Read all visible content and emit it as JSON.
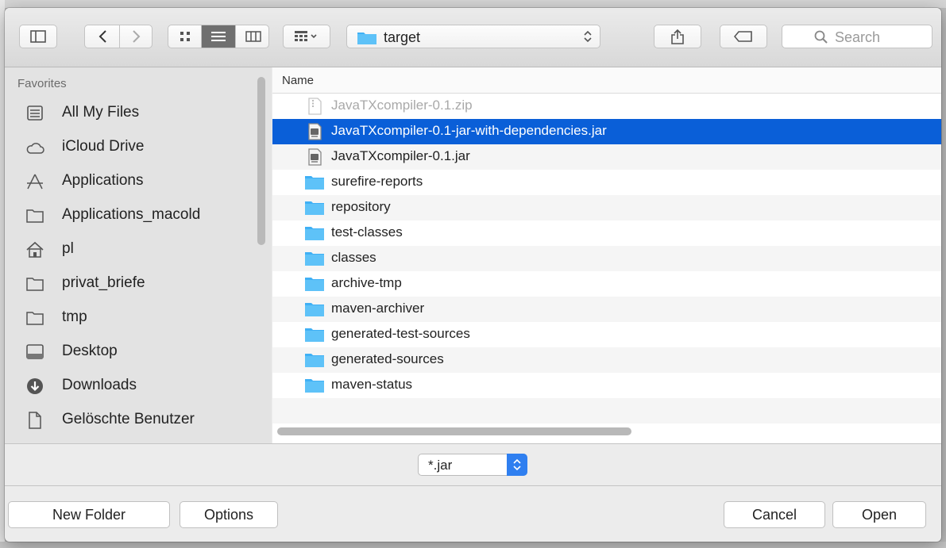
{
  "toolbar": {
    "path_folder": "target",
    "search_placeholder": "Search"
  },
  "sidebar": {
    "section_title": "Favorites",
    "items": [
      {
        "label": "All My Files",
        "icon": "all-files-icon"
      },
      {
        "label": "iCloud Drive",
        "icon": "cloud-icon"
      },
      {
        "label": "Applications",
        "icon": "applications-icon"
      },
      {
        "label": "Applications_macold",
        "icon": "folder-icon"
      },
      {
        "label": "pl",
        "icon": "home-icon"
      },
      {
        "label": "privat_briefe",
        "icon": "folder-icon"
      },
      {
        "label": "tmp",
        "icon": "folder-icon"
      },
      {
        "label": "Desktop",
        "icon": "desktop-icon"
      },
      {
        "label": "Downloads",
        "icon": "downloads-icon"
      },
      {
        "label": "Gelöschte Benutzer",
        "icon": "document-icon"
      }
    ]
  },
  "file_list": {
    "column_header": "Name",
    "rows": [
      {
        "name": "JavaTXcompiler-0.1.zip",
        "type": "zip",
        "state": "disabled"
      },
      {
        "name": "JavaTXcompiler-0.1-jar-with-dependencies.jar",
        "type": "jar",
        "state": "selected"
      },
      {
        "name": "JavaTXcompiler-0.1.jar",
        "type": "jar",
        "state": "normal"
      },
      {
        "name": "surefire-reports",
        "type": "folder",
        "state": "normal"
      },
      {
        "name": "repository",
        "type": "folder",
        "state": "normal"
      },
      {
        "name": "test-classes",
        "type": "folder",
        "state": "normal"
      },
      {
        "name": "classes",
        "type": "folder",
        "state": "normal"
      },
      {
        "name": "archive-tmp",
        "type": "folder",
        "state": "normal"
      },
      {
        "name": "maven-archiver",
        "type": "folder",
        "state": "normal"
      },
      {
        "name": "generated-test-sources",
        "type": "folder",
        "state": "normal"
      },
      {
        "name": "generated-sources",
        "type": "folder",
        "state": "normal"
      },
      {
        "name": "maven-status",
        "type": "folder",
        "state": "normal"
      }
    ]
  },
  "filter": {
    "selected": "*.jar"
  },
  "buttons": {
    "new_folder": "New Folder",
    "options": "Options",
    "cancel": "Cancel",
    "open": "Open"
  },
  "colors": {
    "selection": "#0a5fd8",
    "folder": "#3fb0f5",
    "popup_accent": "#2f7ff0"
  }
}
